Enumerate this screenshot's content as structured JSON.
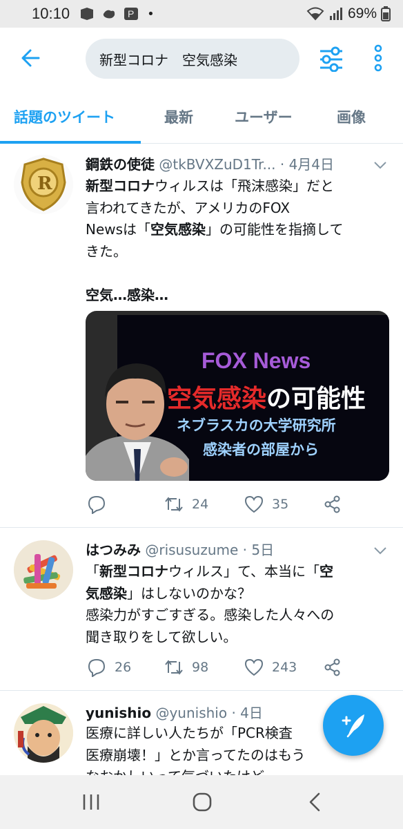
{
  "status_bar": {
    "time": "10:10",
    "dot": "•",
    "battery": "69%"
  },
  "header": {
    "search_value": "新型コロナ　空気感染"
  },
  "tabs": [
    {
      "label": "話題のツイート",
      "active": true
    },
    {
      "label": "最新",
      "active": false
    },
    {
      "label": "ユーザー",
      "active": false
    },
    {
      "label": "画像",
      "active": false
    }
  ],
  "tweets": [
    {
      "name": "鋼鉄の使徒",
      "handle": "@tkBVXZuD1Tr... · 4月4日",
      "body_lines": [
        {
          "bold": "新型コロナ",
          "text": "ウィルスは「飛沫感染」だと"
        },
        {
          "text": "言われてきたが、アメリカのFOX"
        },
        {
          "pre": "Newsは「",
          "bold": "空気感染",
          "text": "」の可能性を指摘して"
        },
        {
          "text": "きた。"
        },
        {
          "text": ""
        },
        {
          "bold": "空気…感染…"
        }
      ],
      "media": {
        "line1": "FOX News",
        "line2_red": "空気感染",
        "line2_white": "の可能性",
        "line3": "ネブラスカの大学研究所",
        "line4": "感染者の部屋から"
      },
      "replies": "",
      "retweets": "24",
      "likes": "35"
    },
    {
      "name": "はつみみ",
      "handle": "@risusuzume · 5日",
      "body_lines": [
        {
          "pre": "「",
          "bold": "新型コロナ",
          "text": "ウィルス」て、本当に「",
          "bold2": "空"
        },
        {
          "bold": "気感染",
          "text": "」はしないのかな？"
        },
        {
          "text": "感染力がすごすぎる。感染した人々への"
        },
        {
          "text": "聞き取りをして欲しい。"
        }
      ],
      "replies": "26",
      "retweets": "98",
      "likes": "243"
    },
    {
      "name": "yunishio",
      "handle": "@yunishio · 4日",
      "body_lines": [
        {
          "text": "医療に詳しい人たちが「PCR検査"
        },
        {
          "text": "医療崩壊！」とか言ってたのはもう"
        },
        {
          "text": "なおかしいって気づいたけど"
        }
      ]
    }
  ],
  "colors": {
    "accent": "#1da1f2",
    "secondary_text": "#657786",
    "divider": "#e1e8ed"
  },
  "icons": [
    "back-arrow-icon",
    "filter-icon",
    "more-icon",
    "chevron-down-icon",
    "reply-icon",
    "retweet-icon",
    "like-icon",
    "share-icon",
    "compose-icon",
    "recents-icon",
    "home-icon",
    "back-nav-icon"
  ]
}
